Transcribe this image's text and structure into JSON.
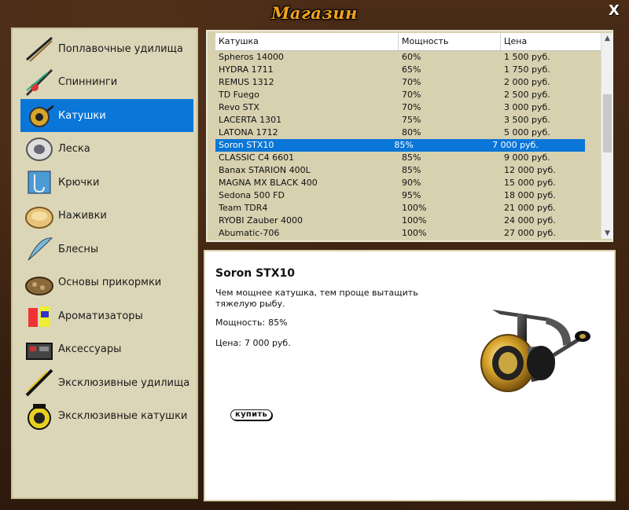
{
  "window": {
    "title": "Магазин",
    "close": "X"
  },
  "categories": [
    {
      "label": "Поплавочные удилища",
      "icon": "float-rod-icon"
    },
    {
      "label": "Спиннинги",
      "icon": "spinning-rod-icon"
    },
    {
      "label": "Катушки",
      "icon": "reel-icon",
      "active": true
    },
    {
      "label": "Леска",
      "icon": "fishing-line-icon"
    },
    {
      "label": "Крючки",
      "icon": "hooks-icon"
    },
    {
      "label": "Наживки",
      "icon": "bait-icon"
    },
    {
      "label": "Блесны",
      "icon": "lure-icon"
    },
    {
      "label": "Основы прикормки",
      "icon": "groundbait-icon"
    },
    {
      "label": "Ароматизаторы",
      "icon": "flavor-icon"
    },
    {
      "label": "Аксессуары",
      "icon": "accessories-icon"
    },
    {
      "label": "Эксклюзивные удилища",
      "icon": "exclusive-rod-icon"
    },
    {
      "label": "Эксклюзивные катушки",
      "icon": "exclusive-reel-icon"
    }
  ],
  "table": {
    "headers": [
      "Катушка",
      "Мощность",
      "Цена"
    ],
    "rows": [
      [
        "Spheros 14000",
        "60%",
        "1 500 руб."
      ],
      [
        "HYDRA 1711",
        "65%",
        "1 750 руб."
      ],
      [
        "REMUS 1312",
        "70%",
        "2 000 руб."
      ],
      [
        "TD Fuego",
        "70%",
        "2 500 руб."
      ],
      [
        "Revo STX",
        "70%",
        "3 000 руб."
      ],
      [
        "LACERTA 1301",
        "75%",
        "3 500 руб."
      ],
      [
        "LATONA 1712",
        "80%",
        "5 000 руб."
      ],
      [
        "Soron STX10",
        "85%",
        "7 000 руб."
      ],
      [
        "CLASSIC C4 6601",
        "85%",
        "9 000 руб."
      ],
      [
        "Banax STARION 400L",
        "85%",
        "12 000 руб."
      ],
      [
        "MAGNA MX BLACK 400",
        "90%",
        "15 000 руб."
      ],
      [
        "Sedona 500 FD",
        "95%",
        "18 000 руб."
      ],
      [
        "Team TDR4",
        "100%",
        "21 000 руб."
      ],
      [
        "RYOBI Zauber 4000",
        "100%",
        "24 000 руб."
      ],
      [
        "Abumatic-706",
        "100%",
        "27 000 руб."
      ]
    ],
    "selected_index": 7
  },
  "detail": {
    "name": "Soron STX10",
    "description": "Чем мощнее катушка, тем проще вытащить тяжелую рыбу.",
    "power_label": "Мощность:",
    "power_value": "85%",
    "price_label": "Цена:",
    "price_value": "7 000 руб.",
    "buy_label": "купить"
  },
  "colors": {
    "accent": "#0a76d8",
    "title": "#f2a21c",
    "panel": "#dcd6b8"
  }
}
